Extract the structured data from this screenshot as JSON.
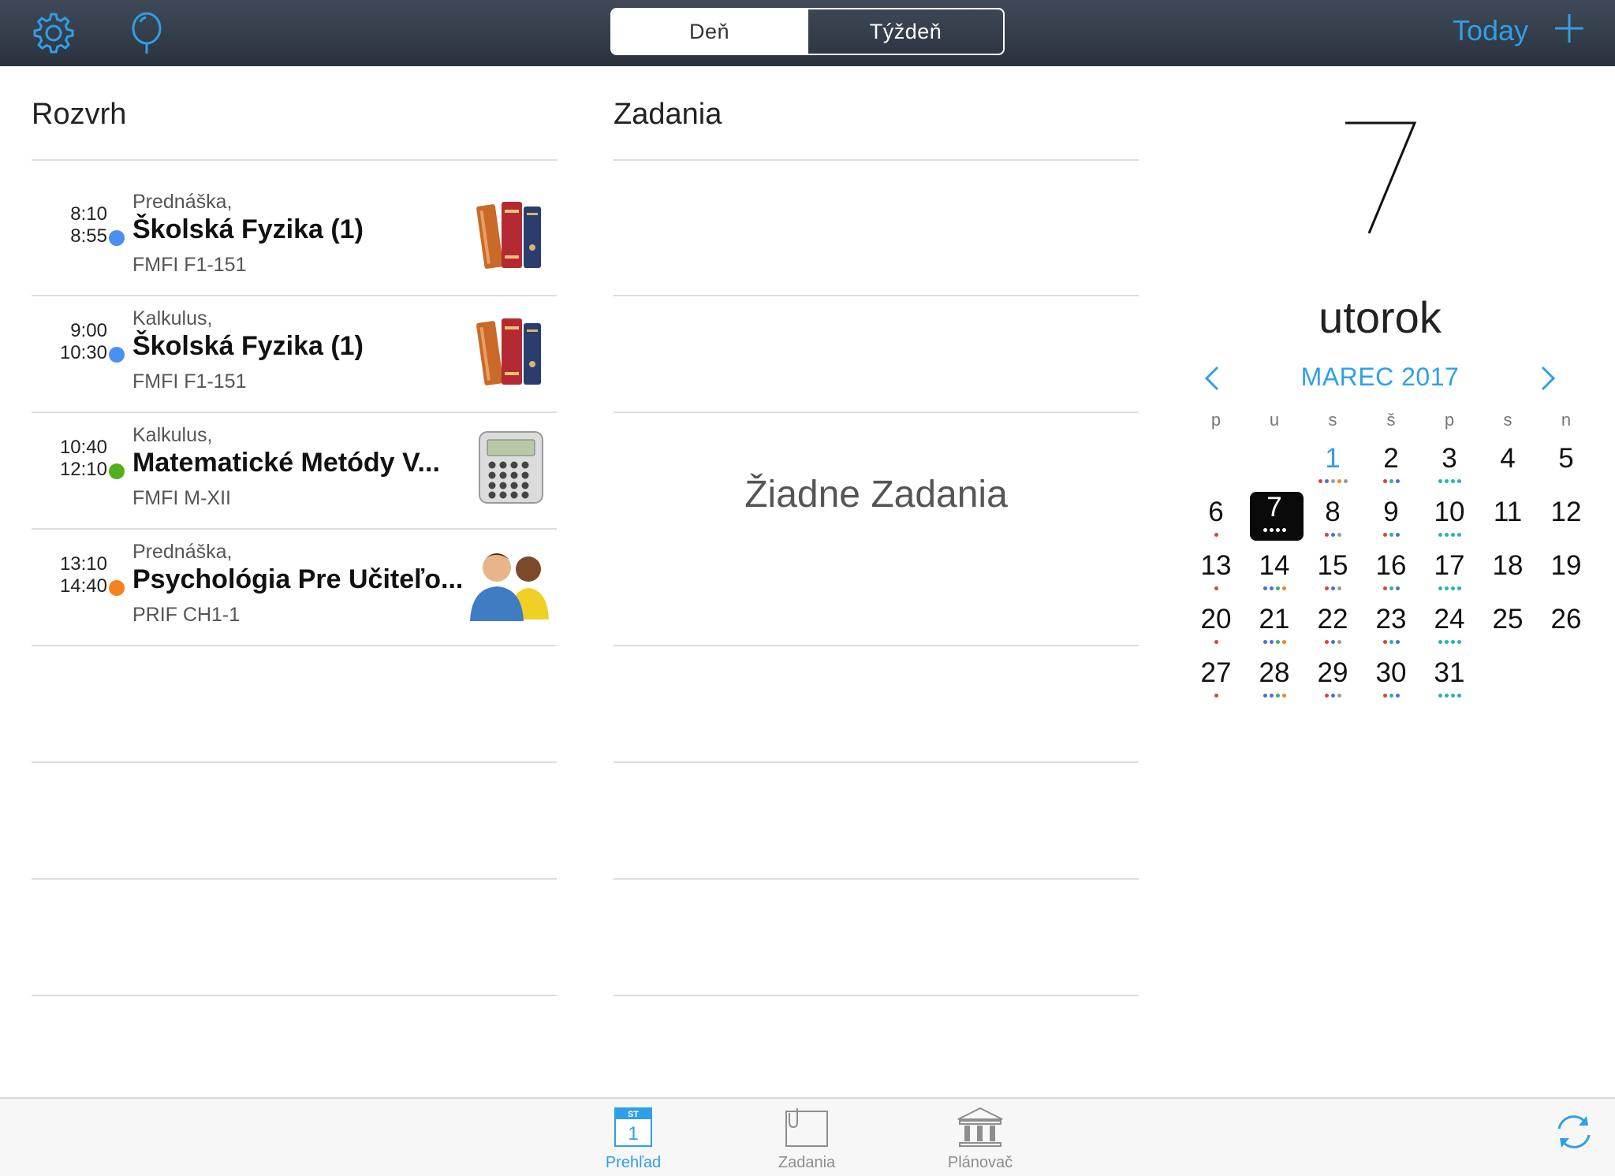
{
  "topbar": {
    "segments": {
      "day": "Deň",
      "week": "Týždeň"
    },
    "today_label": "Today",
    "icons": {
      "settings": "gear-icon",
      "location": "pin-icon",
      "add": "plus-icon"
    }
  },
  "schedule": {
    "title": "Rozvrh",
    "items": [
      {
        "start": "8:10",
        "end": "8:55",
        "type": "Prednáška,",
        "name": "Školská Fyzika (1)",
        "room": "FMFI F1-151",
        "dot_color": "#4a90f2",
        "icon": "books-icon"
      },
      {
        "start": "9:00",
        "end": "10:30",
        "type": "Kalkulus,",
        "name": "Školská Fyzika (1)",
        "room": "FMFI F1-151",
        "dot_color": "#4a90f2",
        "icon": "books-icon"
      },
      {
        "start": "10:40",
        "end": "12:10",
        "type": "Kalkulus,",
        "name": "Matematické Metódy V...",
        "room": "FMFI M-XII",
        "dot_color": "#52b01c",
        "icon": "calculator-icon"
      },
      {
        "start": "13:10",
        "end": "14:40",
        "type": "Prednáška,",
        "name": "Psychológia Pre Učiteľo...",
        "room": "PRIF CH1-1",
        "dot_color": "#f5821f",
        "icon": "people-icon"
      }
    ]
  },
  "assignments": {
    "title": "Zadania",
    "empty_text": "Žiadne Zadania"
  },
  "calendar": {
    "big_day": "7",
    "weekday": "utorok",
    "month": "MAREC 2017",
    "weekdays": [
      "p",
      "u",
      "s",
      "š",
      "p",
      "s",
      "n"
    ],
    "colors": {
      "accent": "#2f9fe6",
      "red": "#e0403a",
      "blue": "#4a6fd6",
      "green": "#2fb36b",
      "teal": "#1fb7b0",
      "orange": "#f5821f",
      "gray": "#999999"
    }
  },
  "tabbar": {
    "tabs": [
      {
        "label": "Prehľad",
        "icon": "calendar-icon",
        "badge_top": "ST",
        "badge_num": "1"
      },
      {
        "label": "Zadania",
        "icon": "clipboard-icon"
      },
      {
        "label": "Plánovač",
        "icon": "building-icon"
      }
    ],
    "sync_icon": "sync-icon"
  }
}
